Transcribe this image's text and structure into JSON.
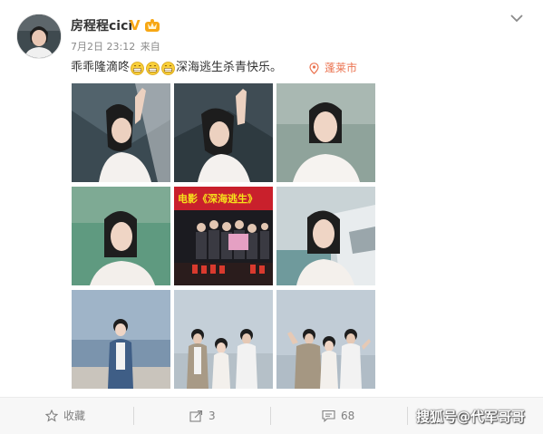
{
  "post": {
    "username": "房程程cici",
    "verified_badge": "V",
    "member_icon": "member-crown-icon",
    "timestamp": "7月2日 23:12",
    "source": "来自",
    "text_before_emoji": "乖乖隆滴咚",
    "emoji": [
      "grin-emoji",
      "grin-emoji",
      "grin-emoji"
    ],
    "text_after_emoji": "深海逃生杀青快乐。",
    "location": "蓬莱市"
  },
  "photos": [
    {
      "name": "photo-1",
      "caption": ""
    },
    {
      "name": "photo-2",
      "caption": ""
    },
    {
      "name": "photo-3",
      "caption": ""
    },
    {
      "name": "photo-4",
      "caption": ""
    },
    {
      "name": "photo-5",
      "caption": "电影《深海逃生》"
    },
    {
      "name": "photo-6",
      "caption": ""
    },
    {
      "name": "photo-7",
      "caption": ""
    },
    {
      "name": "photo-8",
      "caption": ""
    },
    {
      "name": "photo-9",
      "caption": ""
    }
  ],
  "footer": {
    "favorite_label": "收藏",
    "repost_count": "3",
    "comment_count": "68",
    "like_icon": "thumbs-up-icon"
  },
  "watermark": "搜狐号@代军哥哥",
  "colors": {
    "link": "#eb7350",
    "badge": "#f7a714",
    "text": "#333333",
    "muted": "#808080"
  }
}
